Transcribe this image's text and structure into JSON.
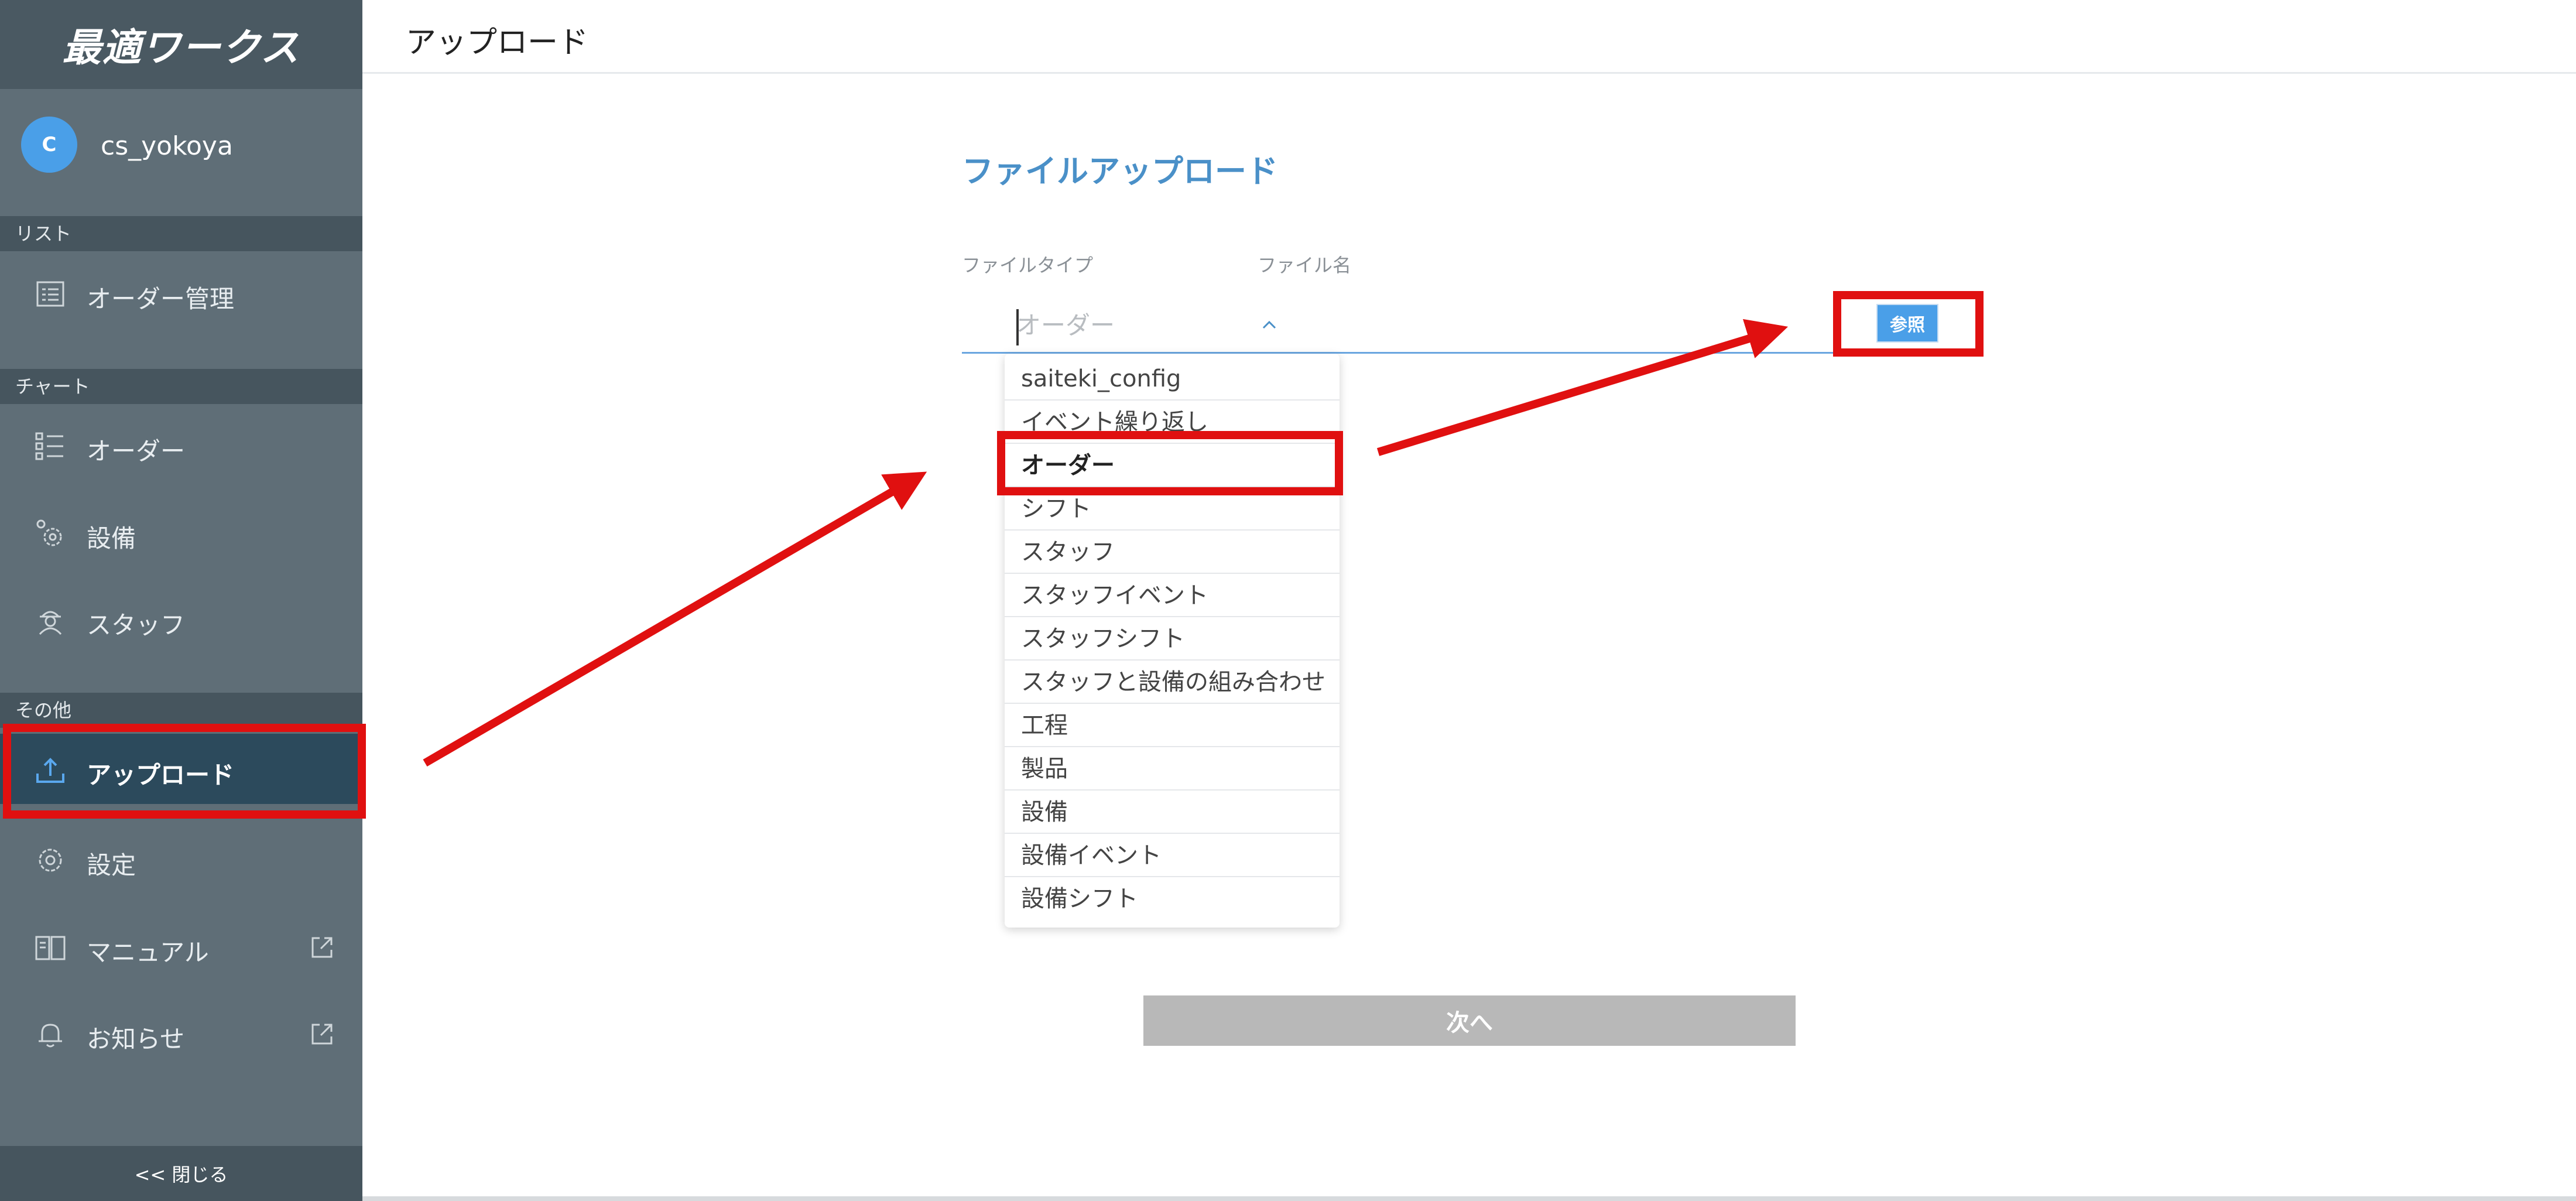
{
  "sidebar": {
    "brand": "最適ワークス",
    "user": {
      "initial": "C",
      "name": "cs_yokoya"
    },
    "sections": {
      "list": "リスト",
      "chart": "チャート",
      "other": "その他"
    },
    "items": {
      "order_mgmt": "オーダー管理",
      "order": "オーダー",
      "equipment": "設備",
      "staff": "スタッフ",
      "upload": "アップロード",
      "settings": "設定",
      "manual": "マニュアル",
      "news": "お知らせ"
    },
    "collapse": "<< 閉じる"
  },
  "header": {
    "title": "アップロード"
  },
  "form": {
    "title": "ファイルアップロード",
    "file_type_label": "ファイルタイプ",
    "file_name_label": "ファイル名",
    "file_type_placeholder": "オーダー",
    "browse_label": "参照",
    "next_label": "次へ",
    "options": [
      "saiteki_config",
      "イベント繰り返し",
      "オーダー",
      "シフト",
      "スタッフ",
      "スタッフイベント",
      "スタッフシフト",
      "スタッフと設備の組み合わせ",
      "工程",
      "製品",
      "設備",
      "設備イベント",
      "設備シフト"
    ],
    "selected_option": "オーダー"
  },
  "colors": {
    "sidebar_bg": "#5f6e77",
    "active_bg": "#2c4a5c",
    "accent": "#4a9fe8",
    "highlight": "#e01010"
  }
}
